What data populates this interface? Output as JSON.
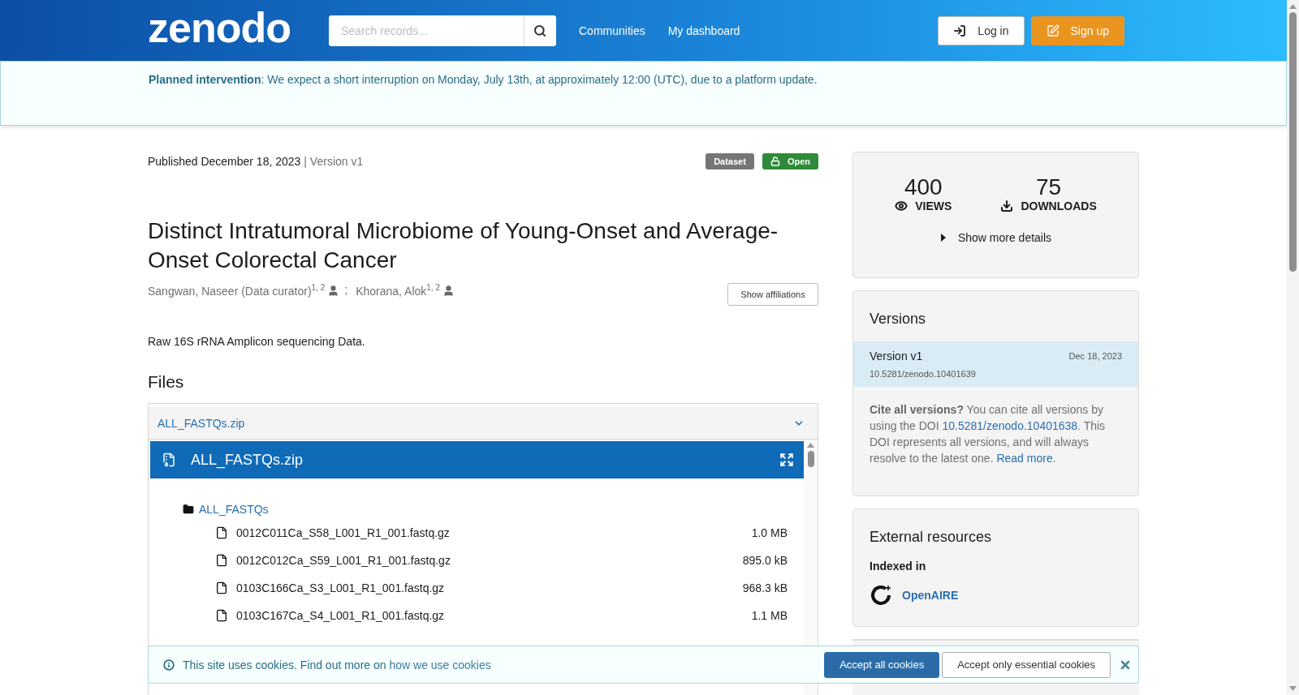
{
  "header": {
    "logo": "zenodo",
    "search": {
      "placeholder": "Search records..."
    },
    "nav": [
      "Communities",
      "My dashboard"
    ],
    "buttons": [
      {
        "label": "Log in",
        "kind": "login"
      },
      {
        "label": "Sign up",
        "kind": "signup"
      }
    ]
  },
  "announcement": {
    "text": "**Planned intervention**: We expect a short interruption on Monday, July 13th, at approximately 12:00 (UTC), due to a platform update."
  },
  "record": {
    "published": "Published December 18, 2023",
    "version": "| Version v1",
    "badges": [
      {
        "label": "Dataset",
        "kind": "type"
      },
      {
        "label": "Open",
        "kind": "access"
      }
    ],
    "title": "Distinct Intratumoral Microbiome of Young-Onset and Average-Onset Colorectal Cancer",
    "creators": [
      {
        "name": "Sangwan, Naseer (Data curator)$^{1, 2}$"
      },
      {
        "name": "Khorana, Alok$^{1, 2}$"
      }
    ],
    "separator": ";",
    "show_affiliations": "Show affiliations",
    "description": "Raw 16S rRNA Amplicon sequencing Data."
  },
  "files": {
    "heading": "Files",
    "accordion": {
      "label": "ALL_FASTQs.zip",
      "expanded": true
    },
    "preview": {
      "title": "ALL_FASTQs.zip",
      "folder": "ALL_FASTQs",
      "entries": [
        {
          "name": "0012C011Ca_S58_L001_R1_001.fastq.gz",
          "size": "1.0 MB"
        },
        {
          "name": "0012C012Ca_S59_L001_R1_001.fastq.gz",
          "size": "895.0 kB"
        },
        {
          "name": "0103C166Ca_S3_L001_R1_001.fastq.gz",
          "size": "968.3 kB"
        },
        {
          "name": "0103C167Ca_S4_L001_R1_001.fastq.gz",
          "size": "1.1 MB"
        }
      ]
    }
  },
  "sidebar": {
    "stats": [
      {
        "value": "400",
        "label": "VIEWS",
        "kind": "views"
      },
      {
        "value": "75",
        "label": "DOWNLOADS",
        "kind": "downloads"
      }
    ],
    "show_more": "Show more details",
    "versions": {
      "heading": "Versions",
      "items": [
        {
          "title": "Version v1",
          "date": "Dec 18, 2023",
          "doi": "10.5281/zenodo.10401639",
          "selected": true
        }
      ],
      "cite": {
        "lead": "Cite all versions?",
        "text1": " You can cite all versions by using the DOI ",
        "doi": "10.5281/zenodo.10401638",
        "text2": ". This DOI represents all versions, and will always resolve to the latest one. ",
        "link": "Read more",
        "end": "."
      }
    },
    "external": {
      "heading": "External resources",
      "subheading": "Indexed in",
      "resources": [
        "OpenAIRE"
      ]
    }
  },
  "cookie_banner": {
    "text": "This site uses cookies. Find out more on ",
    "link": "how we use cookies",
    "buttons": [
      {
        "label": "Accept all cookies",
        "kind": "primary"
      },
      {
        "label": "Accept only essential cookies",
        "kind": "secondary"
      }
    ]
  }
}
